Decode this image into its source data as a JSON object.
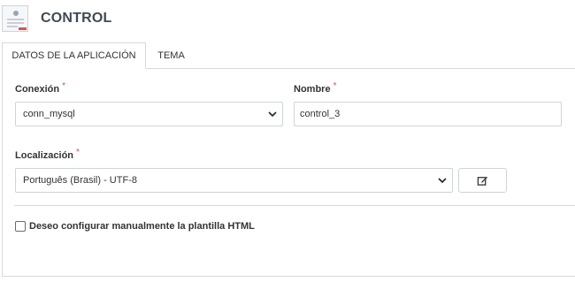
{
  "header": {
    "title": "CONTROL",
    "icon": "app-form-icon"
  },
  "tabs": [
    {
      "label": "DATOS DE LA APLICACIÓN",
      "active": true
    },
    {
      "label": "TEMA",
      "active": false
    }
  ],
  "form": {
    "required_marker": "*",
    "connection": {
      "label": "Conexión",
      "value": "conn_mysql"
    },
    "name": {
      "label": "Nombre",
      "value": "control_3"
    },
    "locale": {
      "label": "Localización",
      "value": "Português (Brasil) - UTF-8",
      "edit_icon": "edit-icon"
    },
    "manual_template": {
      "label": "Deseo configurar manualmente la plantilla HTML",
      "checked": false
    }
  },
  "colors": {
    "required": "#d9534f",
    "border": "#d5d9de",
    "title": "#3f4a56"
  }
}
